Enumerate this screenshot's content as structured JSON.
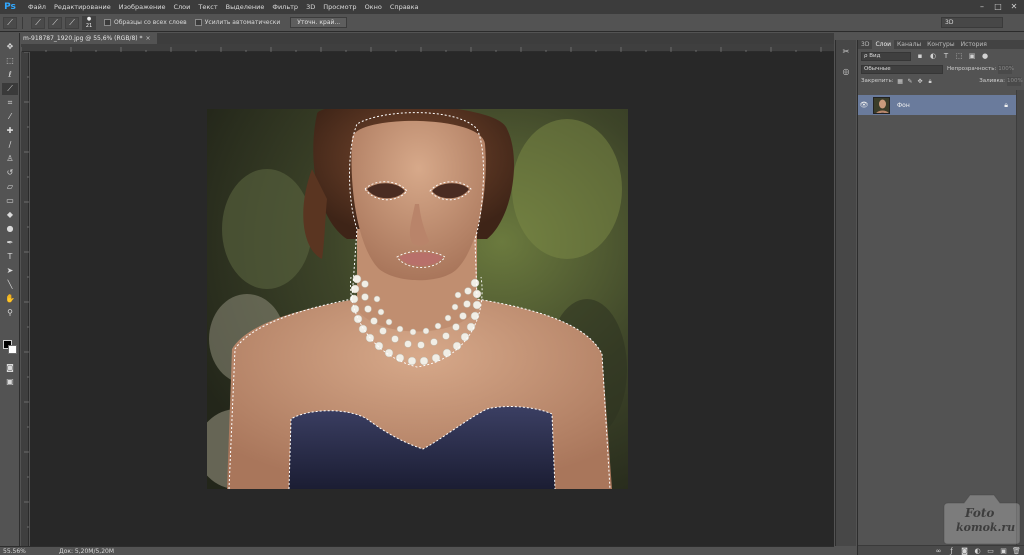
{
  "app": {
    "logo": "Ps"
  },
  "menu": [
    "Файл",
    "Редактирование",
    "Изображение",
    "Слои",
    "Текст",
    "Выделение",
    "Фильтр",
    "3D",
    "Просмотр",
    "Окно",
    "Справка"
  ],
  "window_controls": [
    "–",
    "□",
    "✕"
  ],
  "options_bar": {
    "brush_size": "21",
    "sample_all_layers": "Образцы со всех слоев",
    "auto_enhance": "Усилить автоматически",
    "refine_edge": "Уточн. край...",
    "workspace": "3D"
  },
  "document": {
    "tab_title": "m-918787_1920.jpg @ 55,6% (RGB/8) *",
    "tab_close": "×"
  },
  "status": {
    "zoom": "55.56%",
    "doc_info": "Док: 5,20M/5,20M"
  },
  "layers_panel": {
    "tabs": [
      "3D",
      "Слои",
      "Каналы",
      "Контуры",
      "История"
    ],
    "active_tab": "Слои",
    "filter_label": "Вид",
    "blend_mode": "Обычные",
    "opacity_label": "Непрозрачность:",
    "opacity_value": "100%",
    "lock_label": "Закрепить:",
    "fill_label": "Заливка:",
    "fill_value": "100%",
    "layers": [
      {
        "name": "Фон",
        "locked": true,
        "visible": true
      }
    ]
  },
  "watermark": {
    "line1": "Foto",
    "line2": "komok.ru"
  },
  "colors": {
    "foreground": "#000000",
    "background": "#ffffff",
    "selected_layer": "#6a7b9c",
    "canvas_bg": "#282828"
  }
}
